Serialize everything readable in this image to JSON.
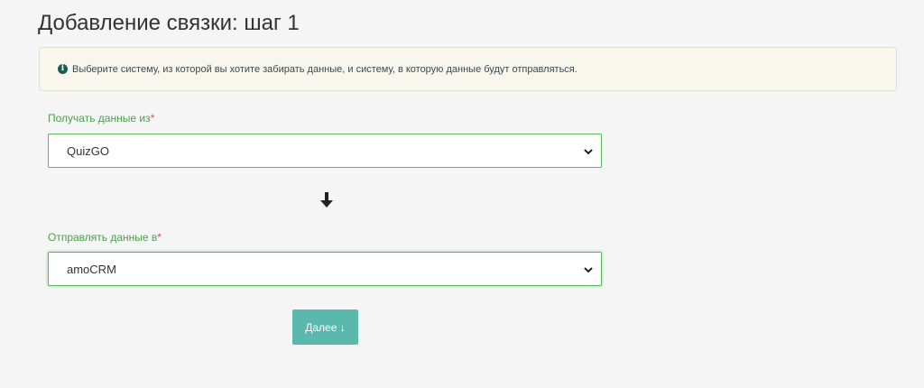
{
  "page": {
    "title": "Добавление связки: шаг 1"
  },
  "alert": {
    "icon": "info-icon",
    "text": "Выберите систему, из которой вы хотите забирать данные, и систему, в которую данные будут отправляться."
  },
  "form": {
    "from_label": "Получать данные из",
    "from_value": "QuizGO",
    "to_label": "Отправлять данные в",
    "to_value": "amoCRM",
    "required_mark": "*",
    "direction_icon": "arrow-down-icon"
  },
  "actions": {
    "next_label": "Далее ↓"
  },
  "colors": {
    "label_green": "#4aa04a",
    "button_teal": "#5ab8ad",
    "required_red": "#d9534f"
  }
}
